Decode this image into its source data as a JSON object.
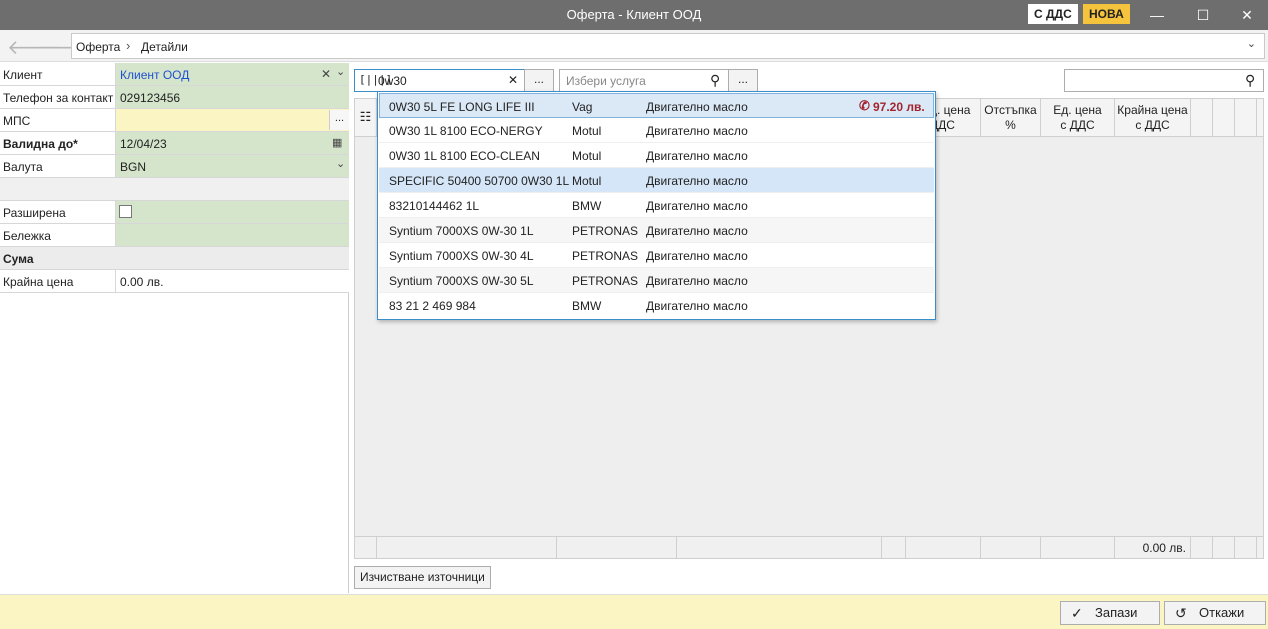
{
  "window": {
    "title": "Оферта - Клиент ООД",
    "badge_vat": "С ДДС",
    "badge_status": "НОВА",
    "minimize": "—",
    "maximize": "☐",
    "close": "✕"
  },
  "nav": {
    "back": "🡐",
    "forward": "🡒",
    "breadcrumb": [
      "Оферта",
      "Детайли"
    ],
    "separator": "›",
    "dropdown": "⌄"
  },
  "form": {
    "fields": [
      {
        "label": "Клиент",
        "value": "Клиент ООД"
      },
      {
        "label": "Телефон за контакт",
        "value": "029123456"
      },
      {
        "label": "МПС",
        "value": ""
      },
      {
        "label": "Валидна до*",
        "value": "12/04/23"
      },
      {
        "label": "Валута",
        "value": "BGN"
      }
    ],
    "extended_label": "Разширена",
    "note_label": "Бележка",
    "sum_section": "Сума",
    "total_label": "Крайна цена",
    "total_value": "0.00 лв.",
    "browse_btn": "...",
    "clear_icon": "✕",
    "drop_icon": "⌄",
    "calendar_icon": "▦"
  },
  "search": {
    "part_query": "0w30",
    "part_clear": "✕",
    "part_browse": "...",
    "service_placeholder": "Избери услуга",
    "service_browse": "...",
    "search_icon": "⚲"
  },
  "grid": {
    "columns": [
      "Ед. цена\nбез ДДС",
      "Отстъпка\n%",
      "Ед. цена\nс ДДС",
      "Крайна цена\nс ДДС"
    ],
    "visible_partial": [
      "д. цена",
      "ДДС"
    ],
    "footer_total": "0.00 лв."
  },
  "dropdown_items": [
    {
      "name": "0W30 5L FE LONG LIFE III",
      "brand": "Vag",
      "category": "Двигателно масло",
      "price": "97.20 лв."
    },
    {
      "name": "0W30 1L 8100 ECO-NERGY",
      "brand": "Motul",
      "category": "Двигателно масло",
      "price": ""
    },
    {
      "name": "0W30 1L 8100 ECO-CLEAN",
      "brand": "Motul",
      "category": "Двигателно масло",
      "price": ""
    },
    {
      "name": "SPECIFIC 50400 50700 0W30 1L",
      "brand": "Motul",
      "category": "Двигателно масло",
      "price": ""
    },
    {
      "name": "83210144462 1L",
      "brand": "BMW",
      "category": "Двигателно масло",
      "price": ""
    },
    {
      "name": "Syntium 7000XS 0W-30 1L",
      "brand": "PETRONAS",
      "category": "Двигателно масло",
      "price": ""
    },
    {
      "name": "Syntium 7000XS 0W-30 4L",
      "brand": "PETRONAS",
      "category": "Двигателно масло",
      "price": ""
    },
    {
      "name": "Syntium 7000XS 0W-30 5L",
      "brand": "PETRONAS",
      "category": "Двигателно масло",
      "price": ""
    },
    {
      "name": "83 21 2 469 984",
      "brand": "BMW",
      "category": "Двигателно масло",
      "price": ""
    }
  ],
  "buttons": {
    "clear_sources": "Изчистване източници",
    "save": "Запази",
    "cancel": "Откажи",
    "save_icon": "✓",
    "cancel_icon": "↺"
  },
  "colors": {
    "form_green": "#d5e5cc",
    "form_yellow": "#fbf5c4",
    "accent_blue": "#3b8ec9",
    "price_red": "#a3232e",
    "badge_yellow": "#f5c43c"
  }
}
